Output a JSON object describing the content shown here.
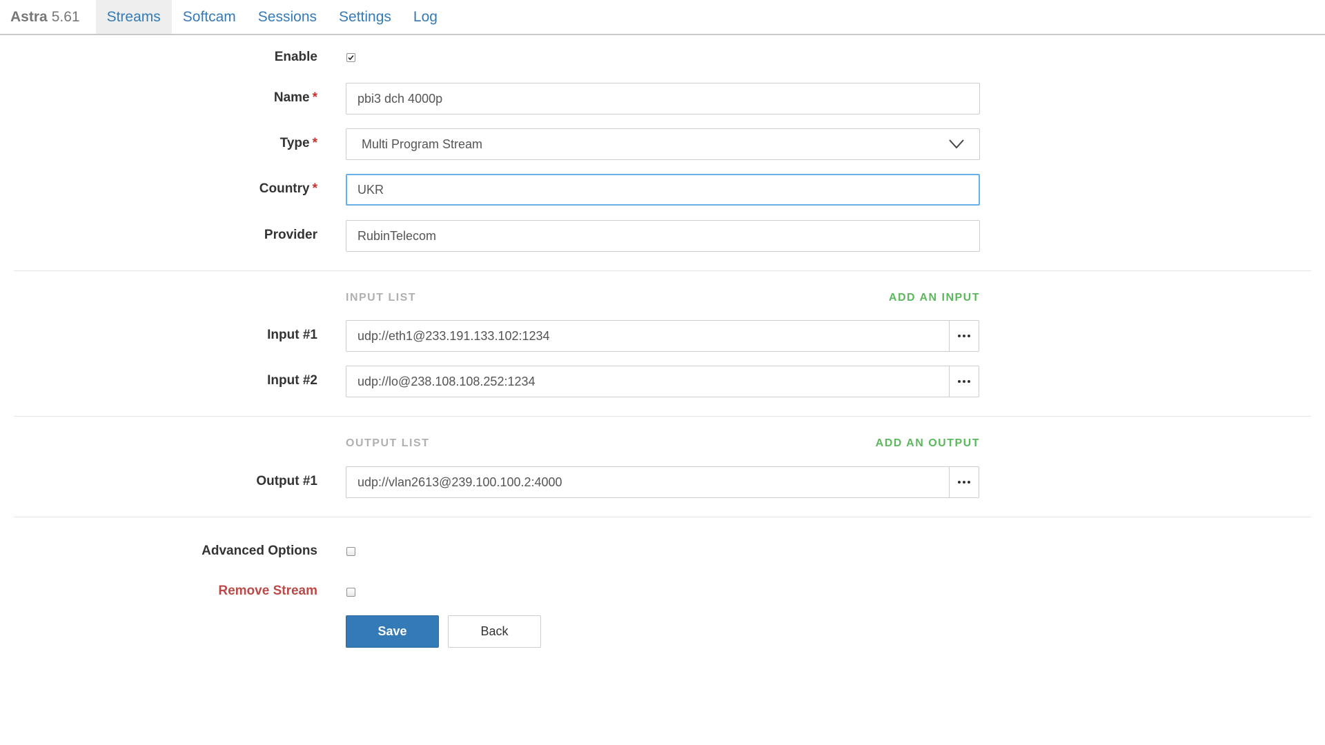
{
  "app": {
    "name": "Astra",
    "version": "5.61"
  },
  "nav": {
    "tabs": [
      {
        "label": "Streams",
        "active": true
      },
      {
        "label": "Softcam",
        "active": false
      },
      {
        "label": "Sessions",
        "active": false
      },
      {
        "label": "Settings",
        "active": false
      },
      {
        "label": "Log",
        "active": false
      }
    ]
  },
  "form": {
    "enable": {
      "label": "Enable",
      "checked": true
    },
    "name": {
      "label": "Name",
      "required_mark": "*",
      "value": "pbi3 dch 4000p"
    },
    "type": {
      "label": "Type",
      "required_mark": "*",
      "value": "Multi Program Stream",
      "icon": "chevron-down-icon"
    },
    "country": {
      "label": "Country",
      "required_mark": "*",
      "value": "UKR"
    },
    "provider": {
      "label": "Provider",
      "value": "RubinTelecom"
    },
    "input_list": {
      "title": "INPUT LIST",
      "add_label": "ADD AN INPUT",
      "items": [
        {
          "label": "Input #1",
          "value": "udp://eth1@233.191.133.102:1234"
        },
        {
          "label": "Input #2",
          "value": "udp://lo@238.108.108.252:1234"
        }
      ]
    },
    "output_list": {
      "title": "OUTPUT LIST",
      "add_label": "ADD AN OUTPUT",
      "items": [
        {
          "label": "Output #1",
          "value": "udp://vlan2613@239.100.100.2:4000"
        }
      ]
    },
    "advanced": {
      "label": "Advanced Options",
      "checked": false
    },
    "remove": {
      "label": "Remove Stream",
      "checked": false,
      "color": "#b94a48"
    },
    "save_label": "Save",
    "back_label": "Back"
  },
  "colors": {
    "link": "#337ab7",
    "primary": "#337ab7",
    "success": "#5cb85c",
    "danger": "#b94a48",
    "required": "#c9302c"
  }
}
